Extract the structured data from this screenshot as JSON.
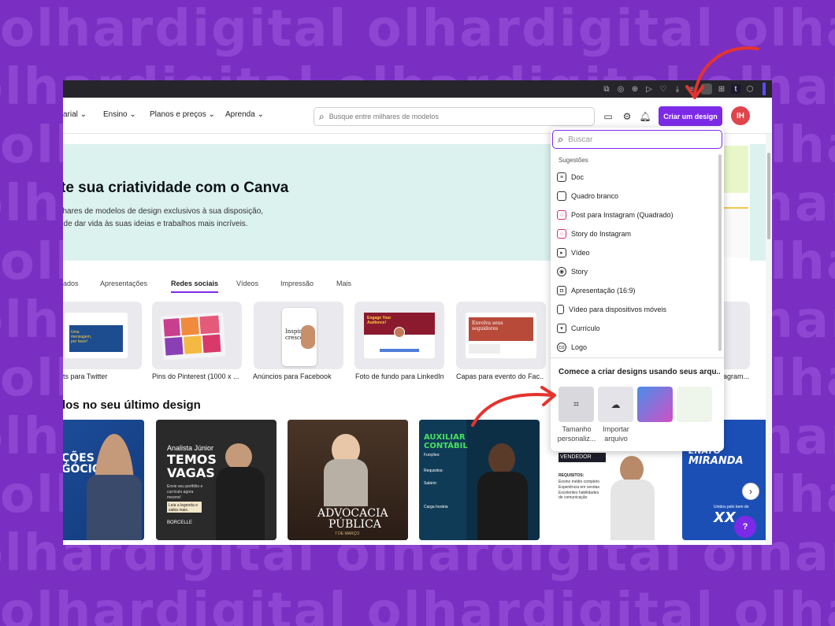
{
  "background_pattern_text": "olhardigital olhardigital olhardigital",
  "colors": {
    "background": "#7a2fc2",
    "accent": "#7d2ae8",
    "annotation": "#e4342f",
    "avatar": "#e0454b"
  },
  "nav": {
    "items": [
      "arial",
      "Ensino",
      "Planos e preços",
      "Aprenda"
    ],
    "search_placeholder": "Busque entre milhares de modelos",
    "cta_label": "Criar um design",
    "avatar_initials": "IH"
  },
  "hero": {
    "title": "te sua criatividade com o Canva",
    "line1": "ilhares de modelos de design exclusivos à sua disposição,",
    "line2": "ode dar vida às suas ideias e trabalhos mais incríveis."
  },
  "tabs": [
    "ados",
    "Apresentações",
    "Redes sociais",
    "Vídeos",
    "Impressão",
    "Mais"
  ],
  "templates": [
    {
      "caption": "ts para Twitter",
      "thumb": "Uma mensagem, por favor!"
    },
    {
      "caption": "Pins do Pinterest (1000 x ..."
    },
    {
      "caption": "Anúncios para Facebook",
      "thumb": "Inspire crescer"
    },
    {
      "caption": "Foto de fundo para LinkedIn",
      "thumb": "Engage Your Audience!"
    },
    {
      "caption": "Capas para evento do Fac...",
      "thumb": "Envolva seus seguidores"
    },
    {
      "caption": "agram..."
    }
  ],
  "section_title": "dos no seu último design",
  "cards": [
    {
      "t1": "ÇÕES",
      "t2": "GÓCIOS"
    },
    {
      "t0": "Analista Júnior",
      "t1": "TEMOS",
      "t2": "VAGAS",
      "sub": "Envie seu portfólio e currículo agora mesmo!",
      "btn": "Leia a legenda e saiba mais.",
      "brand": "BORCELLE"
    },
    {
      "t1": "ADVOCACIA",
      "t2": "PÚBLICA",
      "sub": "7 DE MARÇO"
    },
    {
      "t1": "AUXILIAR",
      "t2": "CONTÁBIL",
      "l1": "Funções:",
      "l2": "Requisitos:",
      "l3": "Salário:",
      "l4": "Carga horária"
    },
    {
      "t1": "VENDEDOR",
      "l1": "REQUISITOS:",
      "l2": "Ensino médio completo",
      "l3": "Experiência em vendas",
      "l4": "Excelentes habilidades de comunicação"
    },
    {
      "t0": "ENATO",
      "t1": "MIRANDA",
      "t2": "XX",
      "sub": "Unidos pelo bem de"
    }
  ],
  "dropdown": {
    "search_placeholder": "Buscar",
    "suggestions_label": "Sugestões",
    "items": [
      {
        "label": "Doc",
        "icon": "doc-icon"
      },
      {
        "label": "Quadro branco",
        "icon": "whiteboard-icon"
      },
      {
        "label": "Post para Instagram (Quadrado)",
        "icon": "instagram-icon"
      },
      {
        "label": "Story do Instagram",
        "icon": "instagram-icon"
      },
      {
        "label": "Vídeo",
        "icon": "video-icon"
      },
      {
        "label": "Story",
        "icon": "story-icon"
      },
      {
        "label": "Apresentação (16:9)",
        "icon": "presentation-icon"
      },
      {
        "label": "Vídeo para dispositivos móveis",
        "icon": "mobile-video-icon"
      },
      {
        "label": "Currículo",
        "icon": "resume-icon"
      },
      {
        "label": "Logo",
        "icon": "logo-icon"
      }
    ],
    "start_heading": "Comece a criar designs usando seus arqu...",
    "tile1_l1": "Tamanho",
    "tile1_l2": "personaliz...",
    "tile2_l1": "Importar",
    "tile2_l2": "arquivo"
  },
  "help_label": "?"
}
